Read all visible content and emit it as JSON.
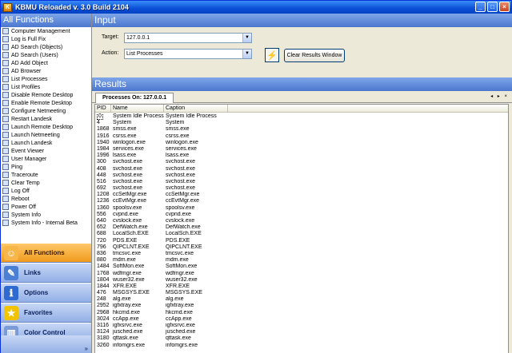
{
  "window": {
    "title": "KBMU Reloaded v. 3.0 Build 2104",
    "controls": [
      "_",
      "□",
      "×"
    ]
  },
  "left_panel": {
    "title": "All Functions",
    "items": [
      "Computer Management",
      "Log is Full Fix",
      "AD Search (Objects)",
      "AD Search (Users)",
      "AD Add Object",
      "AD Browser",
      "List Processes",
      "List Profiles",
      "Disable Remote Desktop",
      "Enable Remote Desktop",
      "Configure Netmeeting",
      "Restart Landesk",
      "Launch Remote Desktop",
      "Launch Netmeeting",
      "Launch Landesk",
      "Event Viewer",
      "User Manager",
      "Ping",
      "Traceroute",
      "Clear Temp",
      "Log Off",
      "Reboot",
      "Power Off",
      "System Info",
      "System Info - Internal Beta"
    ],
    "nav_buttons": [
      {
        "label": "All Functions",
        "icon": "all-functions-icon",
        "glyph": "☺",
        "active": true
      },
      {
        "label": "Links",
        "icon": "links-icon",
        "glyph": "✎",
        "active": false
      },
      {
        "label": "Options",
        "icon": "options-icon",
        "glyph": "ℹ",
        "active": false
      },
      {
        "label": "Favorites",
        "icon": "favorites-icon",
        "glyph": "★",
        "active": false
      },
      {
        "label": "Color Control",
        "icon": "color-control-icon",
        "glyph": "▥",
        "active": false
      }
    ],
    "more_glyph": "»"
  },
  "input_panel": {
    "title": "Input",
    "target_label": "Target:",
    "target_value": "127.0.0.1",
    "action_label": "Action:",
    "action_value": "List Processes",
    "run_glyph": "⚡",
    "clear_button": "Clear Results Window"
  },
  "results": {
    "title": "Results",
    "tab_label": "Processes On: 127.0.0.1",
    "tab_nav": "◂ ▸ ×",
    "columns": [
      "PID",
      "Name",
      "Caption"
    ],
    "rows": [
      [
        "0",
        "System Idle Process",
        "System Idle Process"
      ],
      [
        "4",
        "System",
        "System"
      ],
      [
        "1868",
        "smss.exe",
        "smss.exe"
      ],
      [
        "1916",
        "csrss.exe",
        "csrss.exe"
      ],
      [
        "1940",
        "winlogon.exe",
        "winlogon.exe"
      ],
      [
        "1984",
        "services.exe",
        "services.exe"
      ],
      [
        "1996",
        "lsass.exe",
        "lsass.exe"
      ],
      [
        "300",
        "svchost.exe",
        "svchost.exe"
      ],
      [
        "408",
        "svchost.exe",
        "svchost.exe"
      ],
      [
        "448",
        "svchost.exe",
        "svchost.exe"
      ],
      [
        "516",
        "svchost.exe",
        "svchost.exe"
      ],
      [
        "692",
        "svchost.exe",
        "svchost.exe"
      ],
      [
        "1208",
        "ccSetMgr.exe",
        "ccSetMgr.exe"
      ],
      [
        "1236",
        "ccEvtMgr.exe",
        "ccEvtMgr.exe"
      ],
      [
        "1360",
        "spoolsv.exe",
        "spoolsv.exe"
      ],
      [
        "556",
        "cvpnd.exe",
        "cvpnd.exe"
      ],
      [
        "640",
        "cvslock.exe",
        "cvslock.exe"
      ],
      [
        "652",
        "DefWatch.exe",
        "DefWatch.exe"
      ],
      [
        "688",
        "LocalSch.EXE",
        "LocalSch.EXE"
      ],
      [
        "720",
        "PDS.EXE",
        "PDS.EXE"
      ],
      [
        "796",
        "QIPCLNT.EXE",
        "QIPCLNT.EXE"
      ],
      [
        "836",
        "tmcsvc.exe",
        "tmcsvc.exe"
      ],
      [
        "880",
        "mdm.exe",
        "mdm.exe"
      ],
      [
        "1484",
        "SoftMon.exe",
        "SoftMon.exe"
      ],
      [
        "1768",
        "wdfmgr.exe",
        "wdfmgr.exe"
      ],
      [
        "1804",
        "wuser32.exe",
        "wuser32.exe"
      ],
      [
        "1844",
        "XFR.EXE",
        "XFR.EXE"
      ],
      [
        "476",
        "MSGSYS.EXE",
        "MSGSYS.EXE"
      ],
      [
        "248",
        "alg.exe",
        "alg.exe"
      ],
      [
        "2952",
        "igfxtray.exe",
        "igfxtray.exe"
      ],
      [
        "2968",
        "hkcmd.exe",
        "hkcmd.exe"
      ],
      [
        "3024",
        "ccApp.exe",
        "ccApp.exe"
      ],
      [
        "3116",
        "igfxsrvc.exe",
        "igfxsrvc.exe"
      ],
      [
        "3124",
        "jusched.exe",
        "jusched.exe"
      ],
      [
        "3180",
        "qttask.exe",
        "qttask.exe"
      ],
      [
        "3260",
        "infomgrs.exe",
        "infomgrs.exe"
      ]
    ]
  }
}
